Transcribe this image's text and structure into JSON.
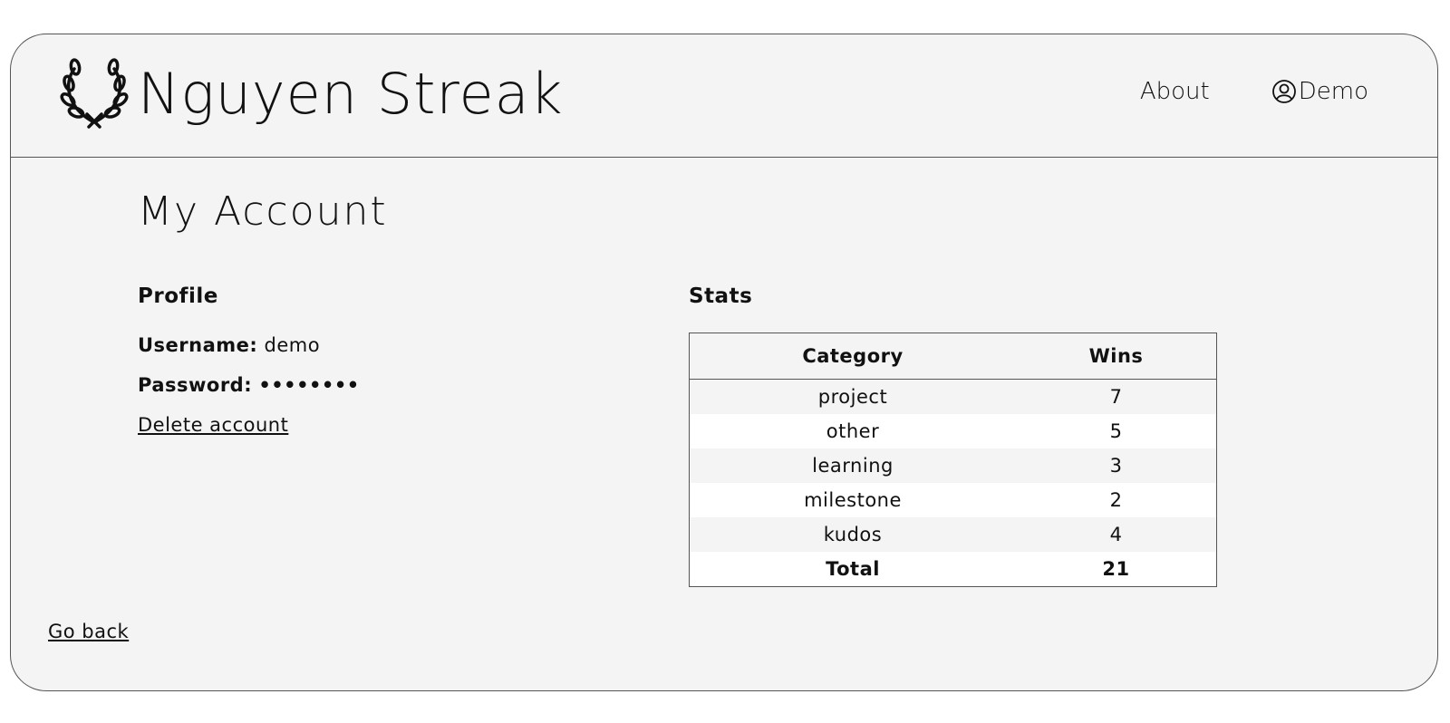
{
  "header": {
    "brand": "Nguyen Streak",
    "logo_icon": "laurel-wreath-icon",
    "nav": {
      "about_label": "About",
      "user_label": "Demo",
      "user_icon": "user-circle-icon"
    }
  },
  "page": {
    "title": "My Account"
  },
  "profile": {
    "title": "Profile",
    "username_label": "Username:",
    "username_value": "demo",
    "password_label": "Password:",
    "password_value": "••••••••",
    "delete_label": "Delete account"
  },
  "stats": {
    "title": "Stats",
    "columns": [
      "Category",
      "Wins"
    ],
    "rows": [
      {
        "category": "project",
        "wins": "7"
      },
      {
        "category": "other",
        "wins": "5"
      },
      {
        "category": "learning",
        "wins": "3"
      },
      {
        "category": "milestone",
        "wins": "2"
      },
      {
        "category": "kudos",
        "wins": "4"
      }
    ],
    "total_label": "Total",
    "total_value": "21"
  },
  "footer": {
    "back_label": "Go back"
  },
  "colors": {
    "panel_background": "#f4f4f4",
    "border": "#555555",
    "text": "#111111"
  }
}
